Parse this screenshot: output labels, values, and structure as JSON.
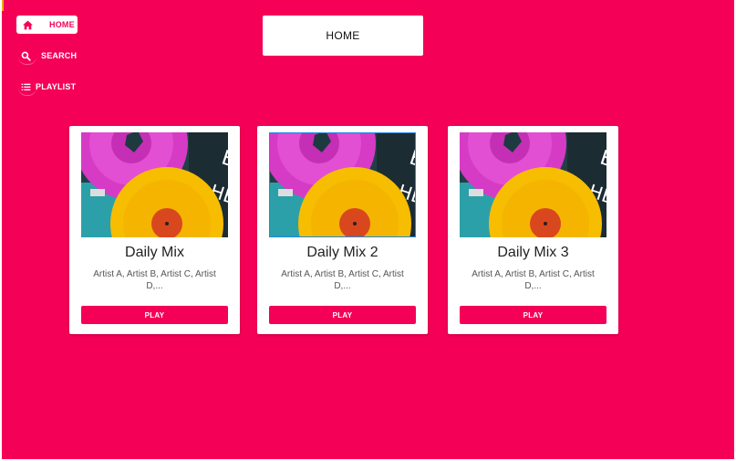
{
  "theme": {
    "accent": "#f50057",
    "surface": "#ffffff",
    "selection": "#1e88e5"
  },
  "nav": {
    "items": [
      {
        "label": "HOME",
        "icon": "home-icon",
        "active": true
      },
      {
        "label": "SEARCH",
        "icon": "search-icon",
        "active": false
      },
      {
        "label": "PLAYLIST",
        "icon": "list-icon",
        "active": false
      }
    ]
  },
  "page": {
    "title": "HOME"
  },
  "cards": [
    {
      "title": "Daily Mix",
      "description": "Artist A, Artist B, Artist C, Artist D,...",
      "button_label": "PLAY",
      "art": "vinyl-records-image"
    },
    {
      "title": "Daily Mix 2",
      "description": "Artist A, Artist B, Artist C, Artist D,...",
      "button_label": "PLAY",
      "art": "vinyl-records-image"
    },
    {
      "title": "Daily Mix 3",
      "description": "Artist A, Artist B, Artist C, Artist D,...",
      "button_label": "PLAY",
      "art": "vinyl-records-image"
    }
  ]
}
